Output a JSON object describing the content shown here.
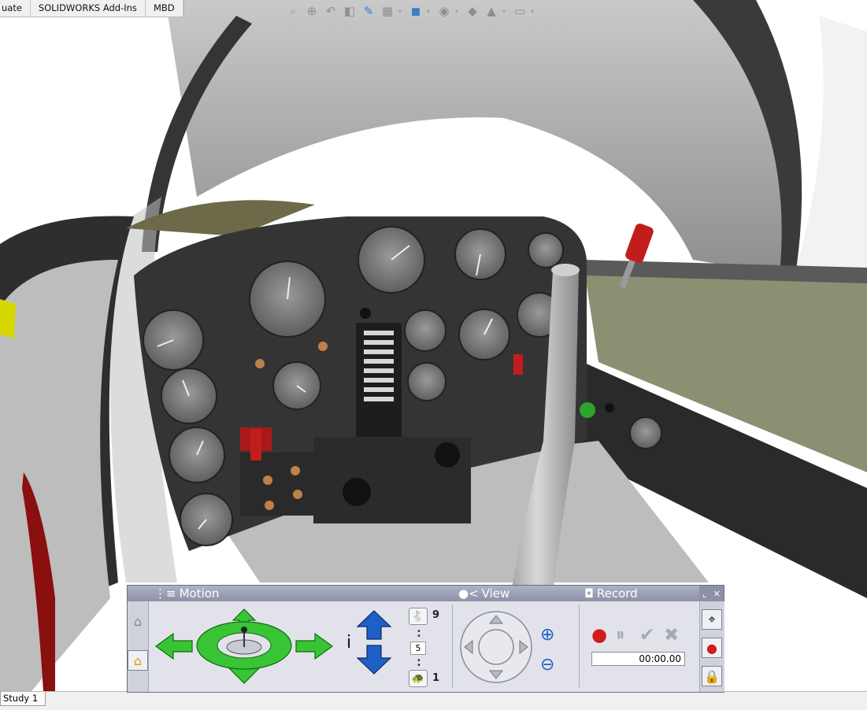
{
  "commandTabs": [
    "uate",
    "SOLIDWORKS Add-Ins",
    "MBD"
  ],
  "hudToolbar": [
    "zoom-to-fit-icon",
    "zoom-area-icon",
    "previous-view-icon",
    "section-view-icon",
    "dynamic-annotation-icon",
    "view-orientation-icon",
    "display-style-icon",
    "hide-show-items-icon",
    "edit-appearance-icon",
    "apply-scene-icon",
    "view-settings-icon"
  ],
  "motionPanel": {
    "motionLabel": "Motion",
    "viewLabel": "View",
    "recordLabel": "Record",
    "speedMax": "9",
    "speedValue": "5",
    "speedMin": "1",
    "timer": "00:00.00"
  },
  "bottomTab": "Study 1",
  "colors": {
    "arrowGreen": "#39c436",
    "arrowBlue": "#1f5fc8",
    "recordRed": "#d21b1b",
    "panelHeader": "#9a9eb4"
  }
}
